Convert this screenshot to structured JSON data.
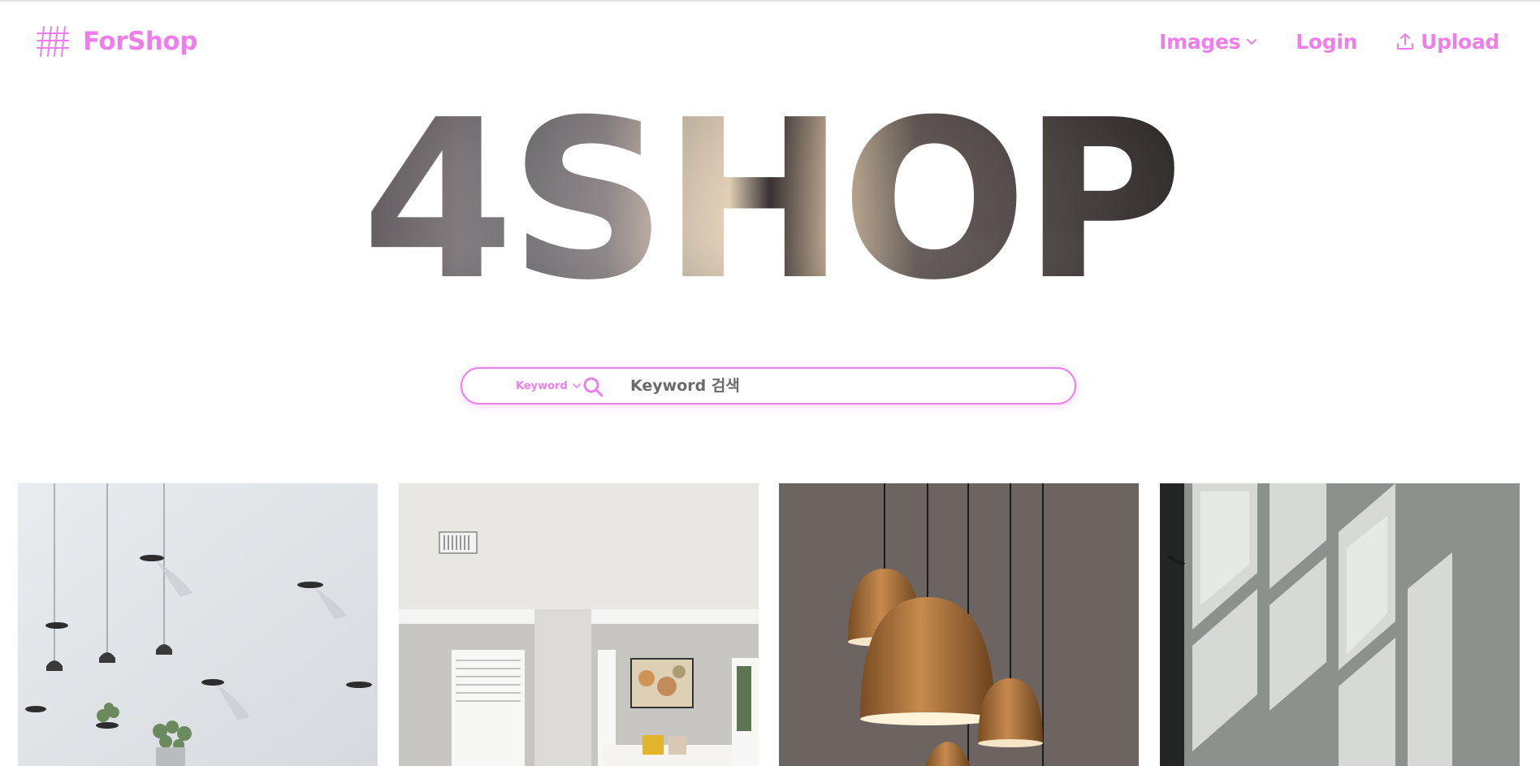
{
  "header": {
    "brand_name": "ForShop",
    "brand_icon": "hashtag-grid-icon",
    "nav": [
      {
        "label": "Images",
        "icon": "chevron-down-icon"
      },
      {
        "label": "Login"
      },
      {
        "label": "Upload",
        "icon": "upload-icon"
      }
    ]
  },
  "hero": {
    "title": "4SHOP"
  },
  "search": {
    "type_label": "Keyword",
    "placeholder": "Keyword 검색"
  },
  "gallery": {
    "items": [
      {
        "subject": "pendant lamps and wall shelves on white wall"
      },
      {
        "subject": "bright living room interior"
      },
      {
        "subject": "copper pendant lamps"
      },
      {
        "subject": "window shadows on wall"
      }
    ]
  },
  "colors": {
    "accent": "#ee7fea",
    "border": "#e6e6e6"
  }
}
